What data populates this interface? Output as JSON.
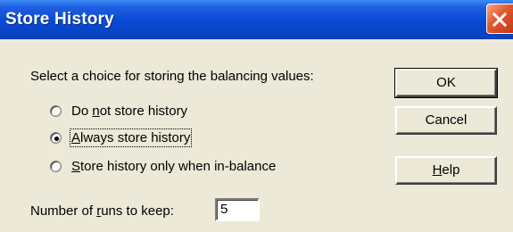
{
  "window": {
    "title": "Store History",
    "close_icon": "close-icon"
  },
  "prompt": "Select a choice for storing the balancing values:",
  "options": [
    {
      "label": "Do not store history",
      "mnemonic": "n",
      "selected": false
    },
    {
      "label": "Always store history",
      "mnemonic": "A",
      "selected": true
    },
    {
      "label": "Store history only when in-balance",
      "mnemonic": "S",
      "selected": false
    }
  ],
  "runs": {
    "label": "Number of runs to keep:",
    "value": "5"
  },
  "buttons": {
    "ok": "OK",
    "cancel": "Cancel",
    "help": "Help"
  },
  "colors": {
    "title_bar": "#0a4bd6",
    "dialog_bg": "#ece9d8",
    "close_button": "#e2562f"
  }
}
